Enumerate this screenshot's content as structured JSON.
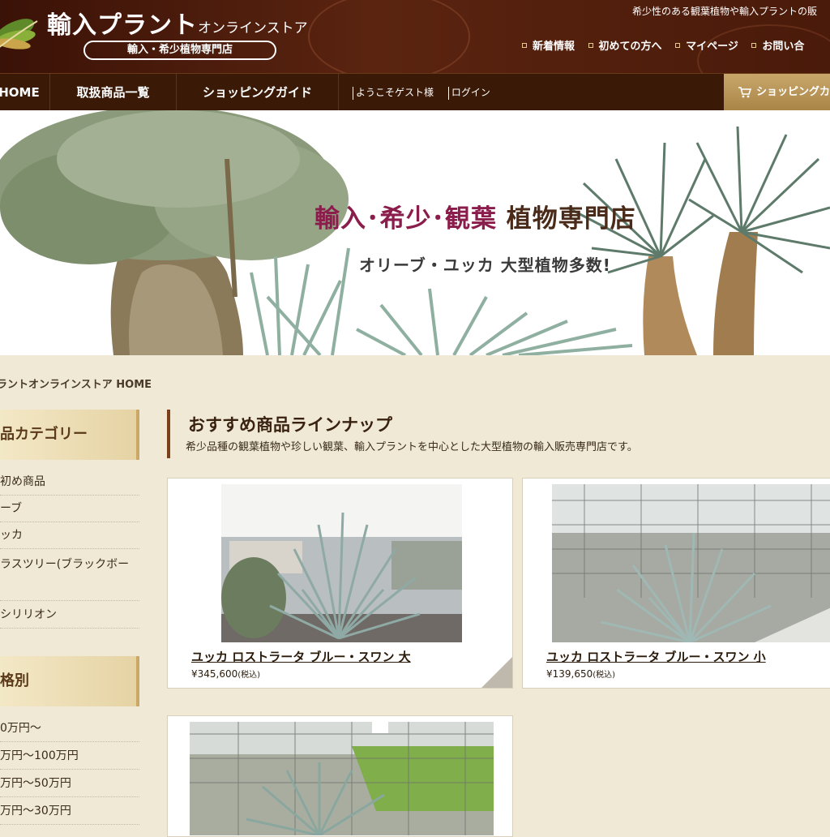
{
  "header": {
    "site_title": "輸入プラント",
    "site_title_sub": "オンラインストア",
    "tagline": "輸入・希少植物専門店",
    "description": "希少性のある観葉植物や輸入プラントの販",
    "links": [
      "新着情報",
      "初めての方へ",
      "マイページ",
      "お問い合"
    ]
  },
  "nav": {
    "items": [
      "HOME",
      "取扱商品一覧",
      "ショッピングガイド"
    ],
    "welcome": "ようこそゲスト様",
    "login": "ログイン",
    "cart": "ショッピングカ"
  },
  "hero": {
    "title_accent": "輸入･希少･観葉",
    "title_rest": "植物専門店",
    "subtitle": "オリーブ・ユッカ 大型植物多数!"
  },
  "breadcrumb": "ラントオンラインストア HOME",
  "sidebar": {
    "category_heading": "品カテゴリー",
    "categories": [
      "初め商品",
      "ーブ",
      "ッカ",
      "ラスツリー(ブラックボー",
      "シリリオン"
    ],
    "price_heading": "格別",
    "prices": [
      "0万円〜",
      "万円〜100万円",
      "万円〜50万円",
      "万円〜30万円"
    ]
  },
  "main": {
    "title": "おすすめ商品ラインナップ",
    "description": "希少品種の観葉植物や珍しい観葉、輸入プラントを中心とした大型植物の輸入販売専門店です。",
    "products": [
      {
        "name": "ユッカ ロストラータ ブルー・スワン 大",
        "price": "¥345,600",
        "tax": "(税込)"
      },
      {
        "name": "ユッカ ロストラータ ブルー・スワン 小",
        "price": "¥139,650",
        "tax": "(税込)"
      }
    ]
  },
  "colors": {
    "header_bg": "#4a1a0a",
    "nav_bg": "#3a1a07",
    "accent_magenta": "#8a1d4b",
    "page_bg": "#efe9d6",
    "cart_gold": "#b8935a"
  },
  "icons": [
    "leaf-logo-icon",
    "cart-icon",
    "bullet-square-icon"
  ]
}
